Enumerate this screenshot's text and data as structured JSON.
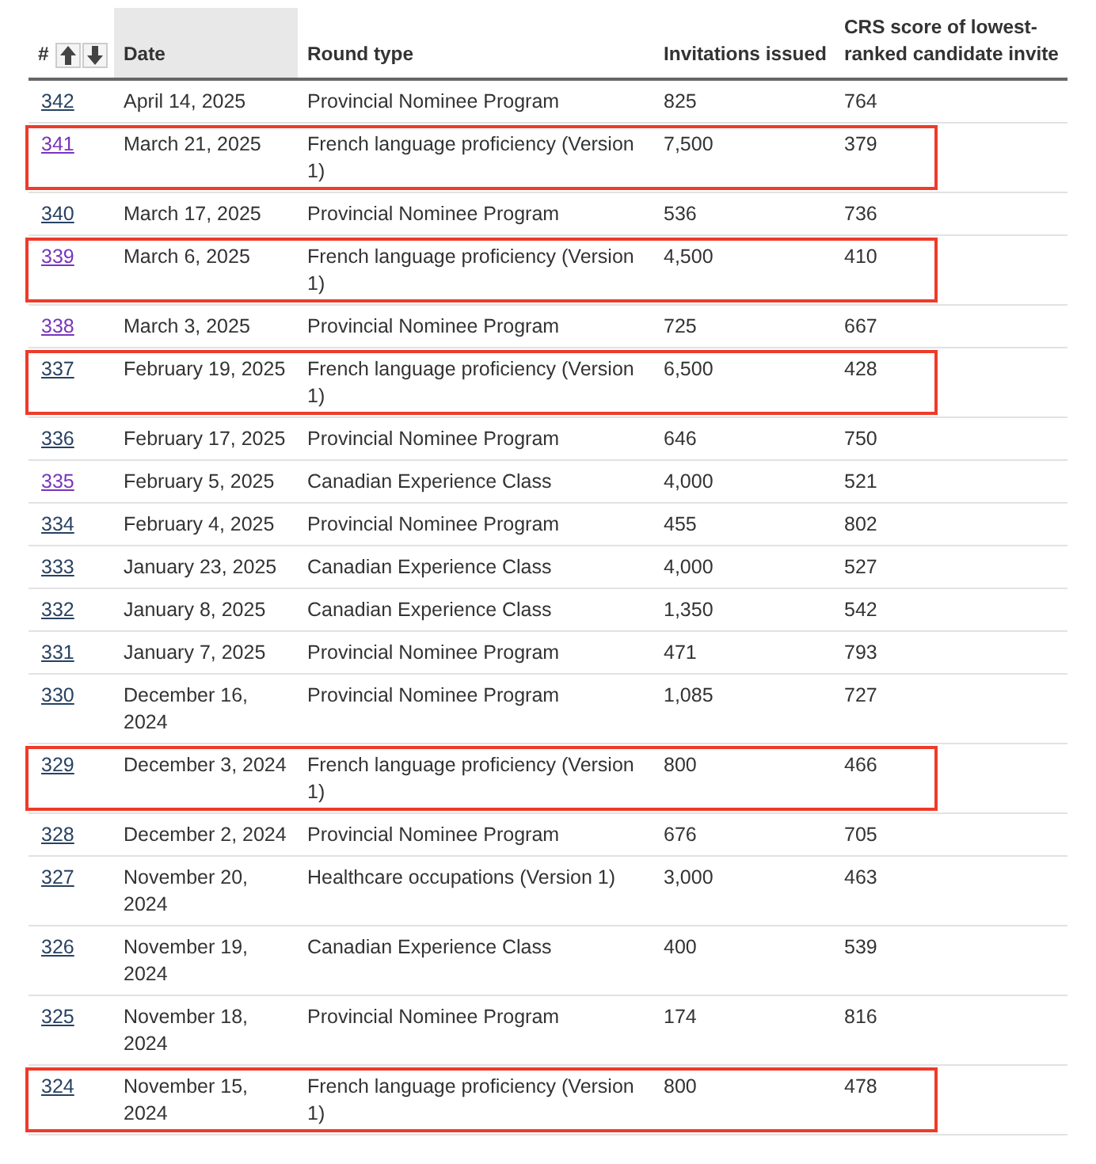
{
  "table": {
    "columns": [
      {
        "label": "#",
        "sorted": false
      },
      {
        "label": "Date",
        "sorted": true
      },
      {
        "label": "Round type",
        "sorted": false
      },
      {
        "label": "Invitations issued",
        "sorted": false
      },
      {
        "label": "CRS score of lowest-ranked candidate invite",
        "sorted": false
      }
    ],
    "rows": [
      {
        "number": "342",
        "visited": false,
        "highlighted": false,
        "date": "April 14, 2025",
        "round_type": "Provincial Nominee Program",
        "invitations": "825",
        "crs": "764"
      },
      {
        "number": "341",
        "visited": true,
        "highlighted": true,
        "date": "March 21, 2025",
        "round_type": "French language proficiency (Version 1)",
        "invitations": "7,500",
        "crs": "379"
      },
      {
        "number": "340",
        "visited": false,
        "highlighted": false,
        "date": "March 17, 2025",
        "round_type": "Provincial Nominee Program",
        "invitations": "536",
        "crs": "736"
      },
      {
        "number": "339",
        "visited": true,
        "highlighted": true,
        "date": "March 6, 2025",
        "round_type": "French language proficiency (Version 1)",
        "invitations": "4,500",
        "crs": "410"
      },
      {
        "number": "338",
        "visited": true,
        "highlighted": false,
        "date": "March 3, 2025",
        "round_type": "Provincial Nominee Program",
        "invitations": "725",
        "crs": "667"
      },
      {
        "number": "337",
        "visited": false,
        "highlighted": true,
        "date": "February 19, 2025",
        "round_type": "French language proficiency (Version 1)",
        "invitations": "6,500",
        "crs": "428"
      },
      {
        "number": "336",
        "visited": false,
        "highlighted": false,
        "date": "February 17, 2025",
        "round_type": "Provincial Nominee Program",
        "invitations": "646",
        "crs": "750"
      },
      {
        "number": "335",
        "visited": true,
        "highlighted": false,
        "date": "February 5, 2025",
        "round_type": "Canadian Experience Class",
        "invitations": "4,000",
        "crs": "521"
      },
      {
        "number": "334",
        "visited": false,
        "highlighted": false,
        "date": "February 4, 2025",
        "round_type": "Provincial Nominee Program",
        "invitations": "455",
        "crs": "802"
      },
      {
        "number": "333",
        "visited": false,
        "highlighted": false,
        "date": "January 23, 2025",
        "round_type": "Canadian Experience Class",
        "invitations": "4,000",
        "crs": "527"
      },
      {
        "number": "332",
        "visited": false,
        "highlighted": false,
        "date": "January 8, 2025",
        "round_type": "Canadian Experience Class",
        "invitations": "1,350",
        "crs": "542"
      },
      {
        "number": "331",
        "visited": false,
        "highlighted": false,
        "date": "January 7, 2025",
        "round_type": "Provincial Nominee Program",
        "invitations": "471",
        "crs": "793"
      },
      {
        "number": "330",
        "visited": false,
        "highlighted": false,
        "date": "December 16, 2024",
        "round_type": "Provincial Nominee Program",
        "invitations": "1,085",
        "crs": "727"
      },
      {
        "number": "329",
        "visited": false,
        "highlighted": true,
        "date": "December 3, 2024",
        "round_type": "French language proficiency (Version 1)",
        "invitations": "800",
        "crs": "466"
      },
      {
        "number": "328",
        "visited": false,
        "highlighted": false,
        "date": "December 2, 2024",
        "round_type": "Provincial Nominee Program",
        "invitations": "676",
        "crs": "705"
      },
      {
        "number": "327",
        "visited": false,
        "highlighted": false,
        "date": "November 20, 2024",
        "round_type": "Healthcare occupations (Version 1)",
        "invitations": "3,000",
        "crs": "463"
      },
      {
        "number": "326",
        "visited": false,
        "highlighted": false,
        "date": "November 19, 2024",
        "round_type": "Canadian Experience Class",
        "invitations": "400",
        "crs": "539"
      },
      {
        "number": "325",
        "visited": false,
        "highlighted": false,
        "date": "November 18, 2024",
        "round_type": "Provincial Nominee Program",
        "invitations": "174",
        "crs": "816"
      },
      {
        "number": "324",
        "visited": false,
        "highlighted": true,
        "date": "November 15, 2024",
        "round_type": "French language proficiency (Version 1)",
        "invitations": "800",
        "crs": "478"
      }
    ]
  }
}
